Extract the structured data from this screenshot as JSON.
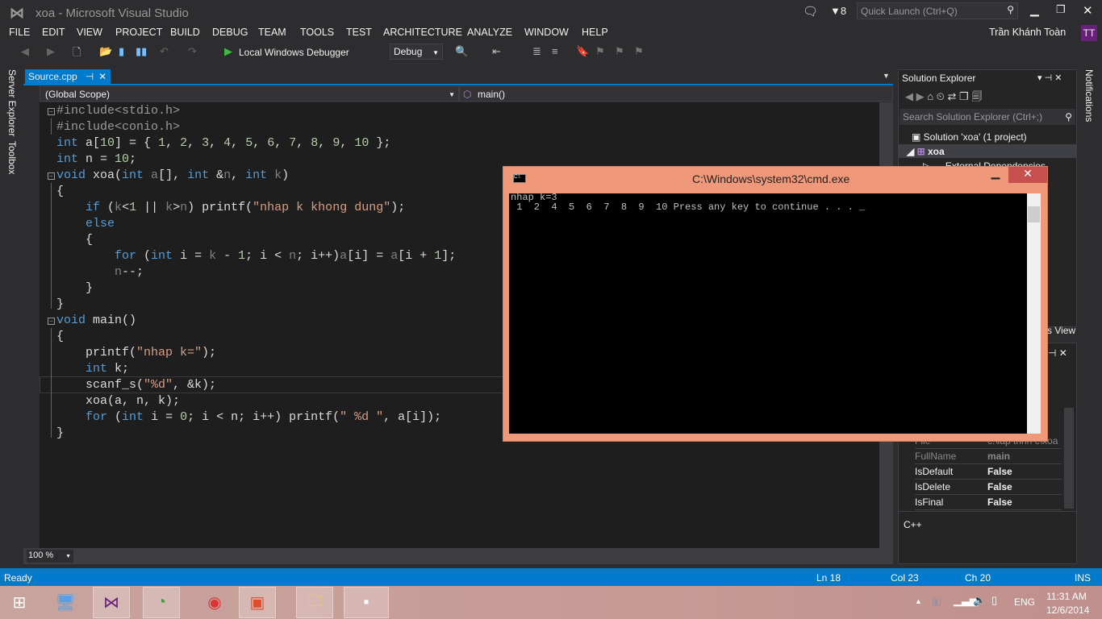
{
  "window": {
    "title": "xoa - Microsoft Visual Studio",
    "notification_count": "8",
    "quick_launch_placeholder": "Quick Launch (Ctrl+Q)",
    "user_name": "Trần Khánh Toàn",
    "user_initials": "TT"
  },
  "menu": [
    "FILE",
    "EDIT",
    "VIEW",
    "PROJECT",
    "BUILD",
    "DEBUG",
    "TEAM",
    "TOOLS",
    "TEST",
    "ARCHITECTURE",
    "ANALYZE",
    "WINDOW",
    "HELP"
  ],
  "toolbar": {
    "debugger_label": "Local Windows Debugger",
    "configuration": "Debug"
  },
  "side_tabs": {
    "left": [
      "Server Explorer",
      "Toolbox"
    ],
    "right": "Notifications"
  },
  "editor": {
    "tab_label": "Source.cpp",
    "scope": "(Global Scope)",
    "member": "main()",
    "zoom": "100 %",
    "lines": [
      [
        [
          "p",
          "#include<stdio.h>"
        ]
      ],
      [
        [
          "p",
          "#include<conio.h>"
        ]
      ],
      [
        [
          "k",
          "int"
        ],
        [
          "d",
          " a["
        ],
        [
          "n",
          "10"
        ],
        [
          "d",
          "] = { "
        ],
        [
          "n",
          "1"
        ],
        [
          "d",
          ", "
        ],
        [
          "n",
          "2"
        ],
        [
          "d",
          ", "
        ],
        [
          "n",
          "3"
        ],
        [
          "d",
          ", "
        ],
        [
          "n",
          "4"
        ],
        [
          "d",
          ", "
        ],
        [
          "n",
          "5"
        ],
        [
          "d",
          ", "
        ],
        [
          "n",
          "6"
        ],
        [
          "d",
          ", "
        ],
        [
          "n",
          "7"
        ],
        [
          "d",
          ", "
        ],
        [
          "n",
          "8"
        ],
        [
          "d",
          ", "
        ],
        [
          "n",
          "9"
        ],
        [
          "d",
          ", "
        ],
        [
          "n",
          "10"
        ],
        [
          "d",
          " };"
        ]
      ],
      [
        [
          "k",
          "int"
        ],
        [
          "d",
          " n = "
        ],
        [
          "n",
          "10"
        ],
        [
          "d",
          ";"
        ]
      ],
      [
        [
          "k",
          "void"
        ],
        [
          "d",
          " xoa("
        ],
        [
          "k",
          "int"
        ],
        [
          "g",
          " a"
        ],
        [
          "d",
          "[], "
        ],
        [
          "k",
          "int"
        ],
        [
          "d",
          " &"
        ],
        [
          "g",
          "n"
        ],
        [
          "d",
          ", "
        ],
        [
          "k",
          "int"
        ],
        [
          "g",
          " k"
        ],
        [
          "d",
          ")"
        ]
      ],
      [
        [
          "d",
          "{"
        ]
      ],
      [
        [
          "d",
          "    "
        ],
        [
          "k",
          "if"
        ],
        [
          "d",
          " ("
        ],
        [
          "g",
          "k"
        ],
        [
          "d",
          "<"
        ],
        [
          "n",
          "1"
        ],
        [
          "d",
          " || "
        ],
        [
          "g",
          "k"
        ],
        [
          "d",
          ">"
        ],
        [
          "g",
          "n"
        ],
        [
          "d",
          ") printf("
        ],
        [
          "s",
          "\"nhap k khong dung\""
        ],
        [
          "d",
          ");"
        ]
      ],
      [
        [
          "d",
          "    "
        ],
        [
          "k",
          "else"
        ]
      ],
      [
        [
          "d",
          "    {"
        ]
      ],
      [
        [
          "d",
          "        "
        ],
        [
          "k",
          "for"
        ],
        [
          "d",
          " ("
        ],
        [
          "k",
          "int"
        ],
        [
          "d",
          " i = "
        ],
        [
          "g",
          "k"
        ],
        [
          "d",
          " - "
        ],
        [
          "n",
          "1"
        ],
        [
          "d",
          "; i < "
        ],
        [
          "g",
          "n"
        ],
        [
          "d",
          "; i++)"
        ],
        [
          "g",
          "a"
        ],
        [
          "d",
          "[i] = "
        ],
        [
          "g",
          "a"
        ],
        [
          "d",
          "[i + "
        ],
        [
          "n",
          "1"
        ],
        [
          "d",
          "];"
        ]
      ],
      [
        [
          "d",
          "        "
        ],
        [
          "g",
          "n"
        ],
        [
          "d",
          "--;"
        ]
      ],
      [
        [
          "d",
          "    }"
        ]
      ],
      [
        [
          "d",
          "}"
        ]
      ],
      [
        [
          "k",
          "void"
        ],
        [
          "d",
          " main()"
        ]
      ],
      [
        [
          "d",
          "{"
        ]
      ],
      [
        [
          "d",
          "    printf("
        ],
        [
          "s",
          "\"nhap k=\""
        ],
        [
          "d",
          ");"
        ]
      ],
      [
        [
          "d",
          "    "
        ],
        [
          "k",
          "int"
        ],
        [
          "d",
          " k;"
        ]
      ],
      [
        [
          "d",
          "    scanf_s("
        ],
        [
          "s",
          "\"%d\""
        ],
        [
          "d",
          ", &k);"
        ]
      ],
      [
        [
          "d",
          "    xoa(a, n, k);"
        ]
      ],
      [
        [
          "d",
          "    "
        ],
        [
          "k",
          "for"
        ],
        [
          "d",
          " ("
        ],
        [
          "k",
          "int"
        ],
        [
          "d",
          " i = "
        ],
        [
          "n",
          "0"
        ],
        [
          "d",
          "; i < n; i++) printf("
        ],
        [
          "s",
          "\" %d \""
        ],
        [
          "d",
          ", a[i]);"
        ]
      ],
      [
        [
          "d",
          "}"
        ]
      ]
    ]
  },
  "solution_explorer": {
    "title": "Solution Explorer",
    "search_placeholder": "Search Solution Explorer (Ctrl+;)",
    "solution": "Solution 'xoa' (1 project)",
    "project": "xoa",
    "items": [
      "External Dependencies"
    ],
    "bottom_tab": "Class View"
  },
  "properties": {
    "rows": [
      [
        "File",
        "c:\\lap trinh c\\xoa"
      ],
      [
        "FullName",
        "main"
      ],
      [
        "IsDefault",
        "False"
      ],
      [
        "IsDelete",
        "False"
      ],
      [
        "IsFinal",
        "False"
      ]
    ],
    "description": "C++"
  },
  "console": {
    "title": "C:\\Windows\\system32\\cmd.exe",
    "lines": [
      "nhap k=3",
      " 1  2  4  5  6  7  8  9  10 Press any key to continue . . . _"
    ]
  },
  "status": {
    "state": "Ready",
    "line": "Ln 18",
    "col": "Col 23",
    "ch": "Ch 20",
    "mode": "INS"
  },
  "taskbar": {
    "apps": [
      "start",
      "computer",
      "visual-studio",
      "coc-coc",
      "chrome",
      "foxit-reader",
      "file-explorer",
      "cmd"
    ],
    "language": "ENG",
    "time": "11:31 AM",
    "date": "12/6/2014"
  },
  "colors": {
    "accent": "#007acc",
    "console_frame": "#f0997a",
    "keyword": "#569cd6",
    "string": "#d69d85",
    "number": "#b5cea8"
  }
}
